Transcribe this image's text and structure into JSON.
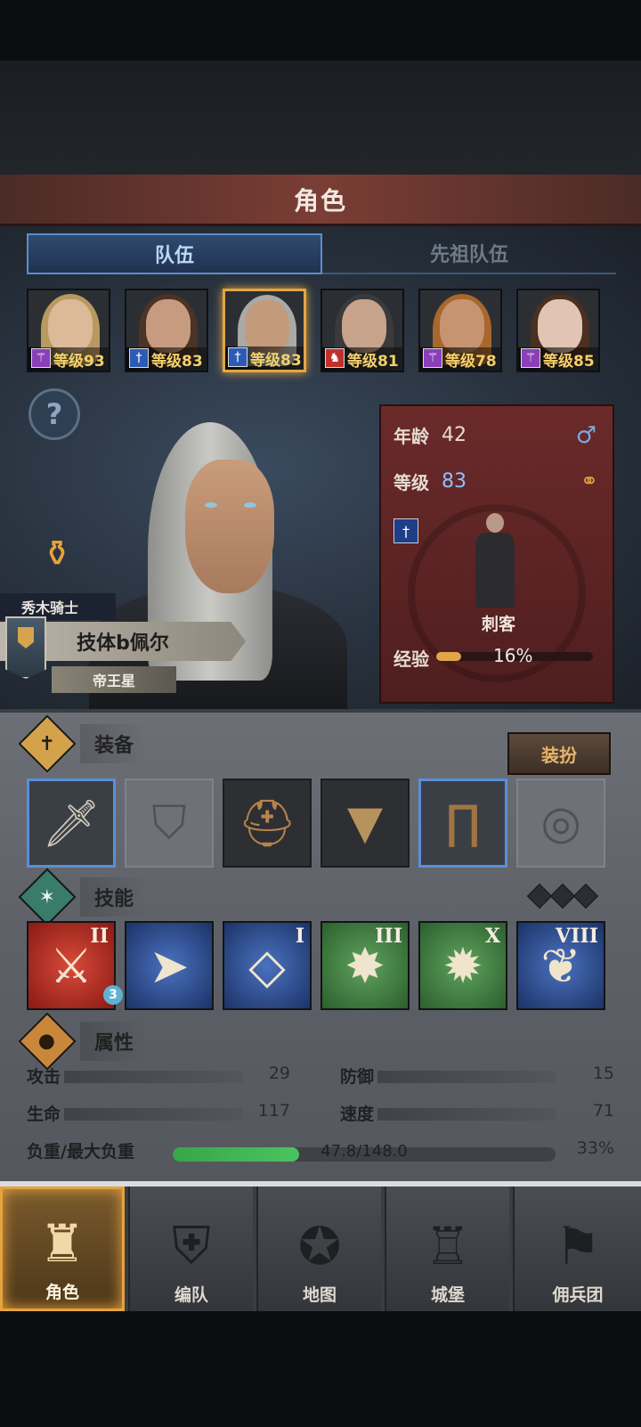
{
  "header": {
    "title": "角色"
  },
  "tabs": [
    {
      "label": "队伍",
      "active": true
    },
    {
      "label": "先祖队伍",
      "active": false
    }
  ],
  "roster": [
    {
      "level": "等级93",
      "class_icon": "staff-icon",
      "class_color": "#8a3fb8",
      "hair": "#b89a60",
      "skin": "#dbb999"
    },
    {
      "level": "等级83",
      "class_icon": "dagger-icon",
      "class_color": "#2c5bb5",
      "hair": "#4b3326",
      "skin": "#c79b7f"
    },
    {
      "level": "等级83",
      "class_icon": "dagger-icon",
      "class_color": "#2c5bb5",
      "hair": "#a9a9a5",
      "skin": "#c39a7b",
      "selected": true
    },
    {
      "level": "等级81",
      "class_icon": "beast-icon",
      "class_color": "#c0302a",
      "hair": "#3a3a3c",
      "skin": "#c7a38c"
    },
    {
      "level": "等级78",
      "class_icon": "staff-icon",
      "class_color": "#8a3fb8",
      "hair": "#a8672c",
      "skin": "#c69470"
    },
    {
      "level": "等级85",
      "class_icon": "staff-icon",
      "class_color": "#8a3fb8",
      "hair": "#4b2f20",
      "skin": "#e2c4b4"
    }
  ],
  "hero": {
    "rank": "秀木骑士",
    "name": "技体b佩尔",
    "title": "帝王星"
  },
  "info": {
    "age_label": "年龄",
    "age": "42",
    "level_label": "等级",
    "level": "83",
    "class_name": "刺客",
    "exp_label": "经验",
    "exp_pct_text": "16%",
    "exp_fraction": 0.16
  },
  "equipment": {
    "title": "装备",
    "dress_label": "装扮",
    "slots": [
      {
        "icon": "sword-icon",
        "state": "blue-frame"
      },
      {
        "icon": "shield-icon",
        "state": "empty"
      },
      {
        "icon": "helmet-icon",
        "state": "filled"
      },
      {
        "icon": "armor-icon",
        "state": "filled"
      },
      {
        "icon": "boots-icon",
        "state": "blue-frame"
      },
      {
        "icon": "ring-icon",
        "state": "empty"
      }
    ]
  },
  "skills": {
    "title": "技能",
    "items": [
      {
        "rank": "II",
        "color": "#b8231c",
        "icon": "slash-skill-icon",
        "badge": "3"
      },
      {
        "rank": "",
        "color": "#2a4a8a",
        "icon": "dash-skill-icon"
      },
      {
        "rank": "I",
        "color": "#2a4a8a",
        "icon": "crystal-skill-icon"
      },
      {
        "rank": "III",
        "color": "#3d7a3e",
        "icon": "burst-skill-icon"
      },
      {
        "rank": "X",
        "color": "#3d7a3e",
        "icon": "explosion-skill-icon"
      },
      {
        "rank": "VIII",
        "color": "#2a4a8a",
        "icon": "wing-skill-icon"
      }
    ]
  },
  "attributes": {
    "title": "属性",
    "attack_label": "攻击",
    "attack": "29",
    "defense_label": "防御",
    "defense": "15",
    "hp_label": "生命",
    "hp": "117",
    "speed_label": "速度",
    "speed": "71",
    "load_label": "负重/最大负重",
    "load_text": "47.8/148.0",
    "load_pct_text": "33%",
    "load_fraction": 0.33
  },
  "nav": [
    {
      "label": "角色",
      "icon": "knight-icon",
      "active": true
    },
    {
      "label": "编队",
      "icon": "helmet-group-icon"
    },
    {
      "label": "地图",
      "icon": "compass-map-icon"
    },
    {
      "label": "城堡",
      "icon": "castle-icon"
    },
    {
      "label": "佣兵团",
      "icon": "mercenary-icon"
    }
  ]
}
